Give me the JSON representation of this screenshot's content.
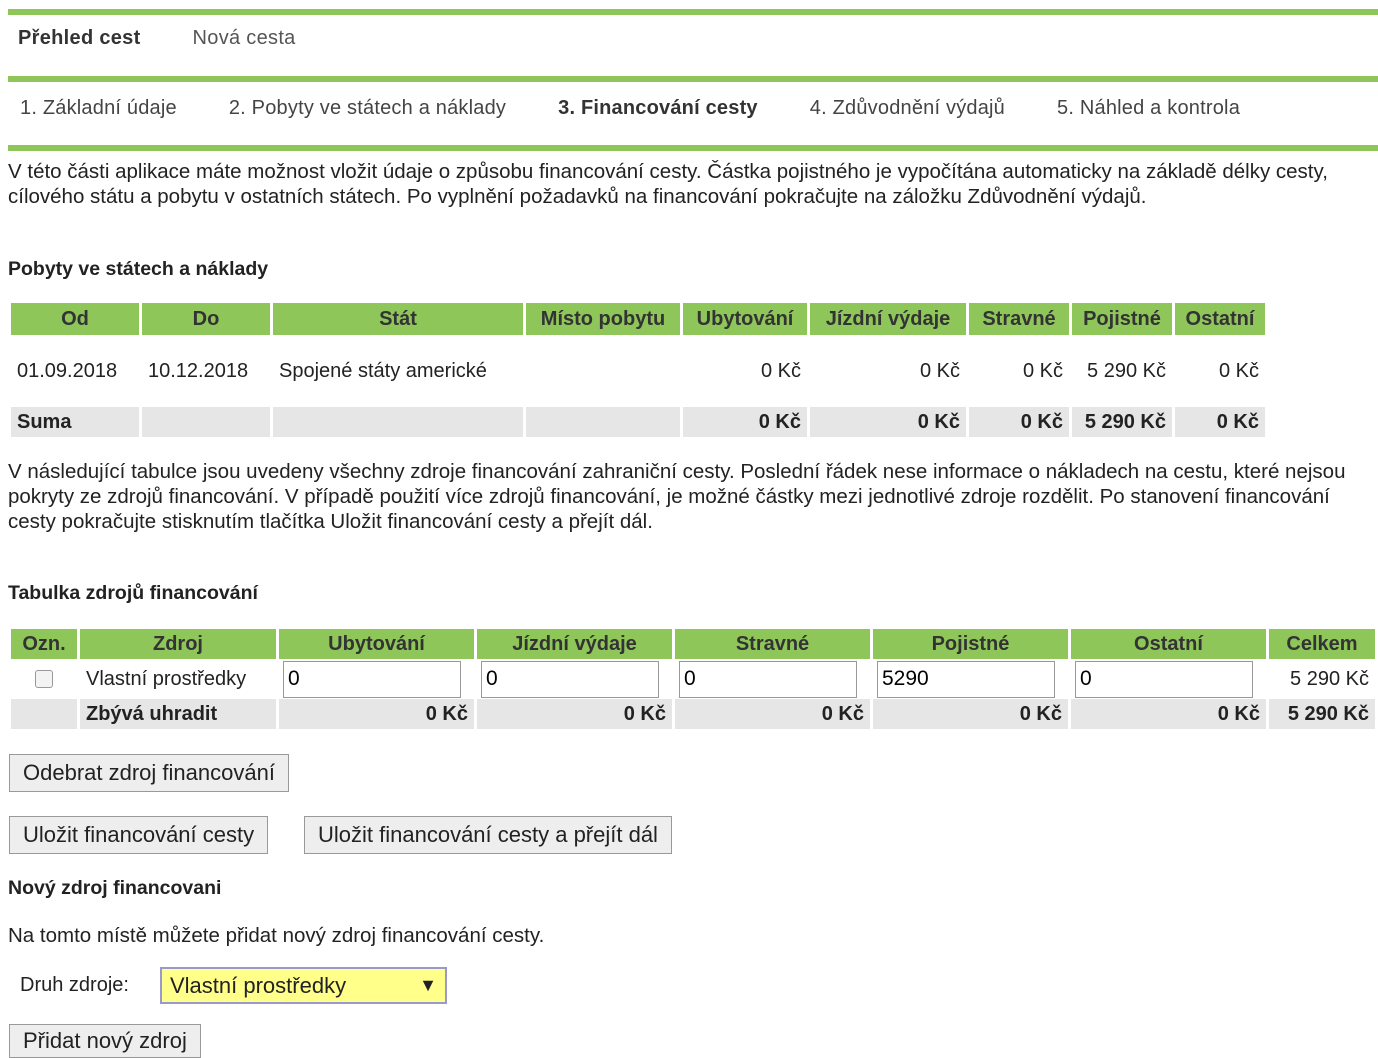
{
  "topnav": {
    "overview": "Přehled cest",
    "new_trip": "Nová cesta"
  },
  "steps": [
    "1. Základní údaje",
    "2. Pobyty ve státech a náklady",
    "3. Financování cesty",
    "4. Zdůvodnění výdajů",
    "5. Náhled a kontrola"
  ],
  "intro1": "V této části aplikace máte možnost vložit údaje o způsobu financování cesty. Částka pojistného je vypočítána automaticky na základě délky cesty, cílového státu a pobytu v ostatních státech. Po vyplnění požadavků na financování pokračujte na záložku Zdůvodnění výdajů.",
  "stays": {
    "title": "Pobyty ve státech a náklady",
    "headers": [
      "Od",
      "Do",
      "Stát",
      "Místo pobytu",
      "Ubytování",
      "Jízdní výdaje",
      "Stravné",
      "Pojistné",
      "Ostatní"
    ],
    "row": {
      "from": "01.09.2018",
      "to": "10.12.2018",
      "state": "Spojené státy americké",
      "place": "",
      "lodging": "0 Kč",
      "travel": "0 Kč",
      "meals": "0 Kč",
      "insurance": "5 290 Kč",
      "other": "0 Kč"
    },
    "sum": {
      "label": "Suma",
      "lodging": "0 Kč",
      "travel": "0 Kč",
      "meals": "0 Kč",
      "insurance": "5 290 Kč",
      "other": "0 Kč"
    }
  },
  "intro2": "V následující tabulce jsou uvedeny všechny zdroje financování zahraniční cesty. Poslední řádek nese informace o nákladech na cestu, které nejsou pokryty ze zdrojů financování. V případě použití více zdrojů financování, je možné částky mezi jednotlivé zdroje rozdělit. Po stanovení financování cesty pokračujte stisknutím tlačítka Uložit financování cesty a přejít dál.",
  "funding": {
    "title": "Tabulka zdrojů financování",
    "headers": [
      "Ozn.",
      "Zdroj",
      "Ubytování",
      "Jízdní výdaje",
      "Stravné",
      "Pojistné",
      "Ostatní",
      "Celkem"
    ],
    "row": {
      "source": "Vlastní prostředky",
      "lodging": "0",
      "travel": "0",
      "meals": "0",
      "insurance": "5290",
      "other": "0",
      "total": "5 290 Kč"
    },
    "remaining": {
      "label": "Zbývá uhradit",
      "lodging": "0 Kč",
      "travel": "0 Kč",
      "meals": "0 Kč",
      "insurance": "0 Kč",
      "other": "0 Kč",
      "total": "5 290 Kč"
    }
  },
  "buttons": {
    "remove": "Odebrat zdroj financování",
    "save": "Uložit financování cesty",
    "save_next": "Uložit financování cesty a přejít dál",
    "add": "Přidat nový zdroj"
  },
  "new_source": {
    "title": "Nový zdroj financovani",
    "text": "Na tomto místě můžete přidat nový zdroj financování cesty.",
    "label": "Druh zdroje:",
    "selected": "Vlastní prostředky",
    "arrow": "▼"
  },
  "colors": {
    "accent": "#8fc65a",
    "sum_bg": "#e6e6e6",
    "select_bg": "#ffff8a"
  }
}
